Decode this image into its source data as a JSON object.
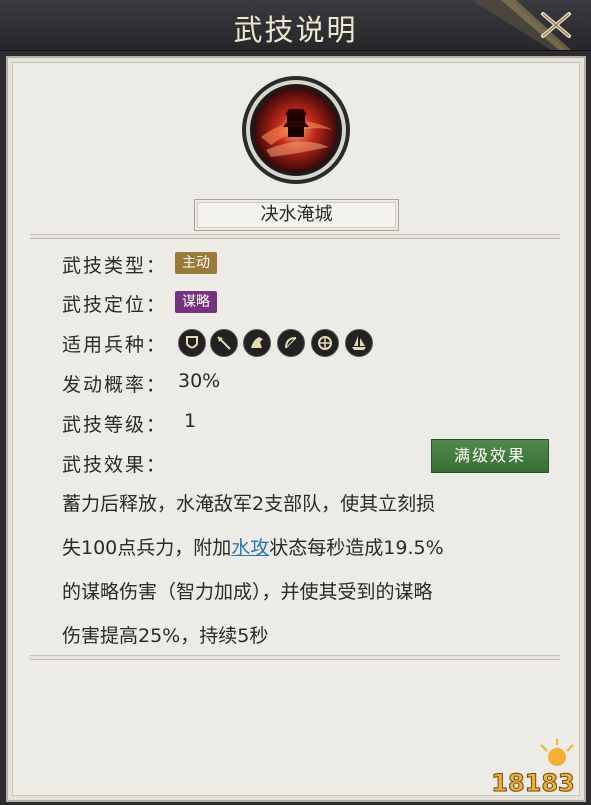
{
  "dialog": {
    "title": "武技说明"
  },
  "skill": {
    "name": "决水淹城",
    "icon": "whirlpool-tower-icon"
  },
  "rows": {
    "type_label": "武技类型：",
    "type_value": "主动",
    "position_label": "武技定位：",
    "position_value": "谋略",
    "troops_label": "适用兵种：",
    "troops": [
      "shield-icon",
      "spear-icon",
      "horse-icon",
      "bow-icon",
      "chariot-icon",
      "ship-icon"
    ],
    "chance_label": "发动概率：",
    "chance_value": "30%",
    "level_label": "武技等级：",
    "level_value": "1",
    "effect_label": "武技效果："
  },
  "max_button": "满级效果",
  "effect": {
    "line1": "蓄力后释放，水淹敌军2支部队，使其立刻损",
    "line2_pre": "失100点兵力，附加",
    "line2_link": "水攻",
    "line2_post": "状态每秒造成19.5%",
    "line3": "的谋略伤害（智力加成），并使其受到的谋略",
    "line4": "伤害提高25%，持续5秒"
  },
  "watermark": "18183",
  "colors": {
    "tag_active": "#9a7a3a",
    "tag_strategy": "#75327f",
    "button_green": "#3a6e36",
    "link_blue": "#2f73b8"
  }
}
